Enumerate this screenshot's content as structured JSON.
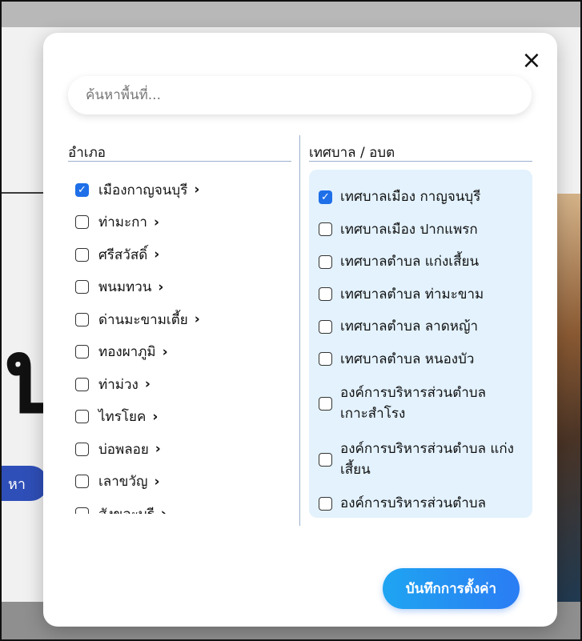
{
  "background": {
    "big_text": "บุ",
    "button_label": "หา"
  },
  "modal": {
    "close_icon": "close-icon",
    "search": {
      "placeholder": "ค้นหาพื้นที่...",
      "value": ""
    },
    "left_column": {
      "header": "อำเภอ",
      "items": [
        {
          "label": "เมืองกาญจนบุรี",
          "checked": true
        },
        {
          "label": "ท่ามะกา",
          "checked": false
        },
        {
          "label": "ศรีสวัสดิ์",
          "checked": false
        },
        {
          "label": "พนมทวน",
          "checked": false
        },
        {
          "label": "ด่านมะขามเตี้ย",
          "checked": false
        },
        {
          "label": "ทองผาภูมิ",
          "checked": false
        },
        {
          "label": "ท่าม่วง",
          "checked": false
        },
        {
          "label": "ไทรโยค",
          "checked": false
        },
        {
          "label": "บ่อพลอย",
          "checked": false
        },
        {
          "label": "เลาขวัญ",
          "checked": false
        },
        {
          "label": "สังขละบุรี",
          "checked": false
        }
      ],
      "chevron": "›"
    },
    "right_column": {
      "header": "เทศบาล / อบต",
      "items": [
        {
          "label": "เทศบาลเมือง กาญจนบุรี",
          "checked": true
        },
        {
          "label": "เทศบาลเมือง ปากแพรก",
          "checked": false
        },
        {
          "label": "เทศบาลตำบล แก่งเสี้ยน",
          "checked": false
        },
        {
          "label": "เทศบาลตำบล ท่ามะขาม",
          "checked": false
        },
        {
          "label": "เทศบาลตำบล ลาดหญ้า",
          "checked": false
        },
        {
          "label": "เทศบาลตำบล หนองบัว",
          "checked": false
        },
        {
          "label": "องค์การบริหารส่วนตำบล เกาะสำโรง",
          "checked": false
        },
        {
          "label": "องค์การบริหารส่วนตำบล แก่งเสี้ยน",
          "checked": false
        },
        {
          "label": "องค์การบริหารส่วนตำบล",
          "checked": false
        }
      ]
    },
    "save_button": "บันทึกการตั้งค่า"
  }
}
